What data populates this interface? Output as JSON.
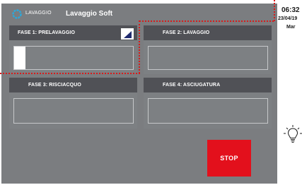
{
  "header": {
    "brand": "LAVAGGIO",
    "title": "Lavaggio Soft"
  },
  "clock": {
    "time": "06:32",
    "date": "23/04/19",
    "day": "Mar"
  },
  "phases": [
    {
      "label": "FASE 1: PRELAVAGGIO",
      "progress": 0.09,
      "active": true
    },
    {
      "label": "FASE 2: LAVAGGIO",
      "progress": 0
    },
    {
      "label": "FASE 3: RISCIACQUO",
      "progress": 0
    },
    {
      "label": "FASE 4: ASCIUGATURA",
      "progress": 0
    }
  ],
  "actions": {
    "stop_label": "STOP"
  },
  "colors": {
    "background": "#7b7d80",
    "panel_header": "#505156",
    "stop": "#e3101c",
    "highlight": "#d81b1b",
    "logo": "#2aa9dc"
  },
  "icons": {
    "logo": "washing-logo-icon",
    "phase_status": "progress-triangle-icon",
    "light": "light-bulb-icon"
  }
}
